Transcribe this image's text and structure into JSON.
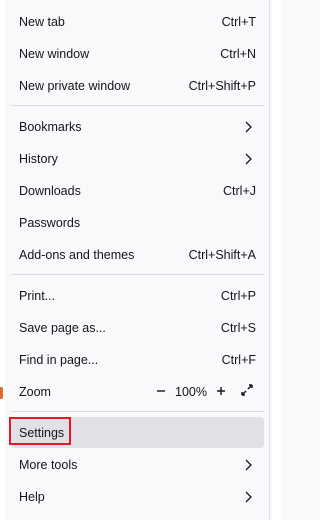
{
  "menu": {
    "group1": [
      {
        "label": "New tab",
        "shortcut": "Ctrl+T"
      },
      {
        "label": "New window",
        "shortcut": "Ctrl+N"
      },
      {
        "label": "New private window",
        "shortcut": "Ctrl+Shift+P"
      }
    ],
    "group2": [
      {
        "label": "Bookmarks",
        "submenu_icon": "chevron-right-icon"
      },
      {
        "label": "History",
        "submenu_icon": "chevron-right-icon"
      },
      {
        "label": "Downloads",
        "shortcut": "Ctrl+J"
      },
      {
        "label": "Passwords"
      },
      {
        "label": "Add-ons and themes",
        "shortcut": "Ctrl+Shift+A"
      }
    ],
    "group3": [
      {
        "label": "Print...",
        "shortcut": "Ctrl+P"
      },
      {
        "label": "Save page as...",
        "shortcut": "Ctrl+S"
      },
      {
        "label": "Find in page...",
        "shortcut": "Ctrl+F"
      }
    ],
    "zoom": {
      "label": "Zoom",
      "value": "100%",
      "minus_icon": "minus-icon",
      "plus_icon": "plus-icon",
      "fullscreen_icon": "fullscreen-icon"
    },
    "group4": [
      {
        "label": "Settings",
        "highlighted": true
      },
      {
        "label": "More tools",
        "submenu_icon": "chevron-right-icon"
      },
      {
        "label": "Help",
        "submenu_icon": "chevron-right-icon"
      }
    ]
  },
  "colors": {
    "background": "#f9f9fb",
    "hover": "#e0e0e6",
    "highlight_border": "#e01b24",
    "text": "#15141a"
  }
}
